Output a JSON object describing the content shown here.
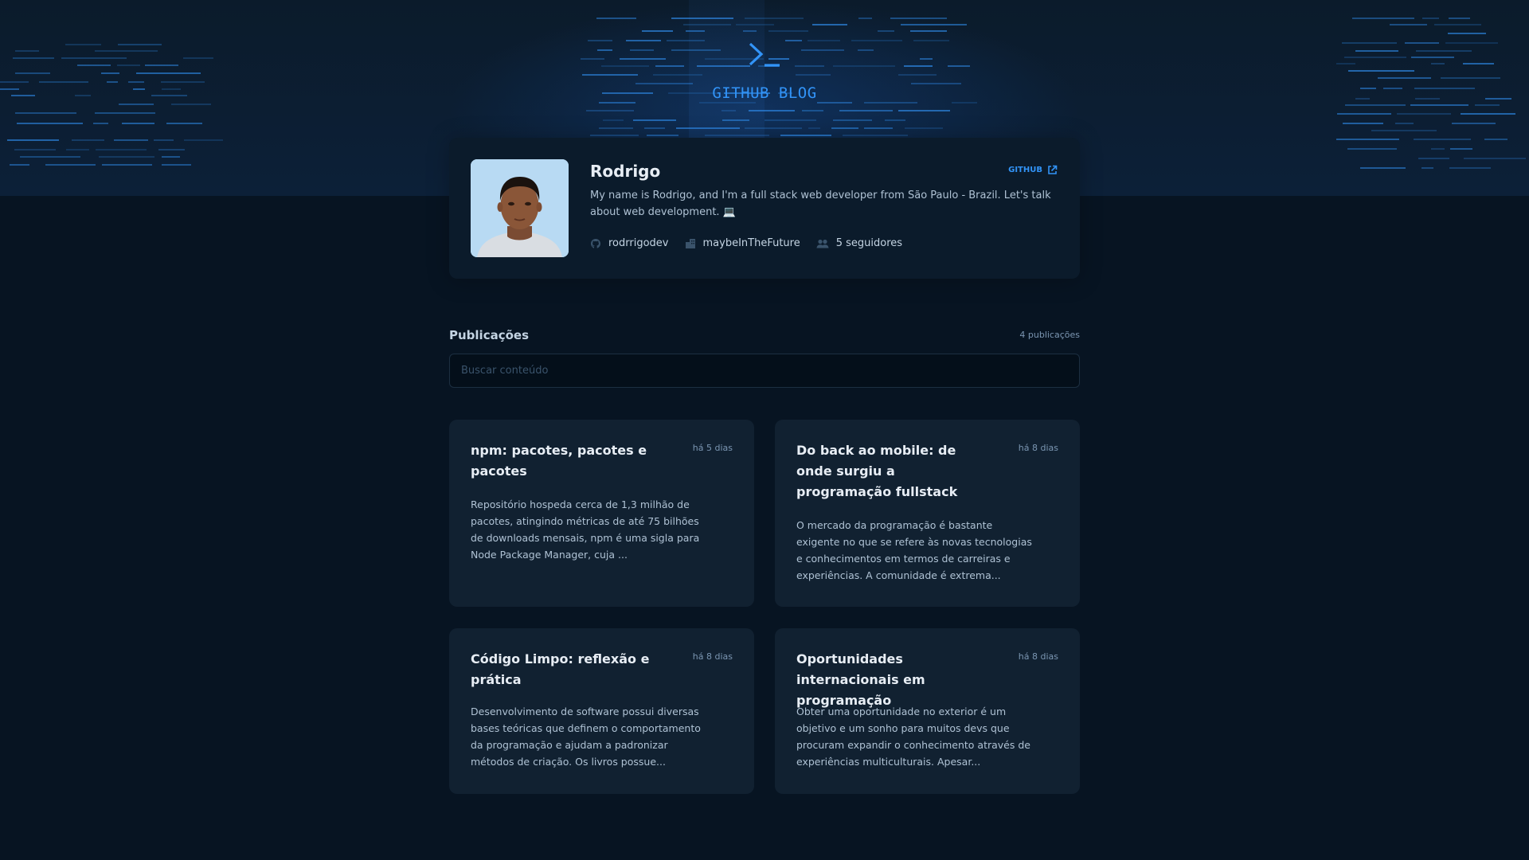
{
  "app": {
    "brand": "GITHUB BLOG",
    "logo_icon": "terminal-prompt-icon",
    "accent_color": "#3294F8"
  },
  "profile": {
    "name": "Rodrigo",
    "github_label": "GITHUB",
    "bio": "My name is Rodrigo, and I'm a full stack web developer from São Paulo - Brazil. Let's talk about web development. 💻",
    "username": "rodrrigodev",
    "company": "maybeInTheFuture",
    "followers": "5 seguidores"
  },
  "publications": {
    "title": "Publicações",
    "count": "4 publicações",
    "search_placeholder": "Buscar conteúdo",
    "posts": [
      {
        "title": "npm: pacotes, pacotes e pacotes",
        "date": "há 5 dias",
        "excerpt": "Repositório hospeda cerca de 1,3 milhão de pacotes, atingindo métricas de até 75 bilhões de downloads mensais, npm é uma sigla para Node Package Manager, cuja ..."
      },
      {
        "title": "Do back ao mobile: de onde surgiu a programação fullstack",
        "date": "há 8 dias",
        "excerpt": "O mercado da programação é bastante exigente no que se refere às novas tecnologias e conhecimentos em termos de carreiras e experiências. A comunidade é extrema..."
      },
      {
        "title": "Código Limpo: reflexão e prática",
        "date": "há 8 dias",
        "excerpt": "Desenvolvimento de software possui diversas bases teóricas que definem o comportamento da programação e ajudam a padronizar métodos de criação. Os livros possue..."
      },
      {
        "title": "Oportunidades internacionais em programação",
        "date": "há 8 dias",
        "excerpt": "Obter uma oportunidade no exterior é um objetivo e um sonho para muitos devs que procuram expandir o conhecimento através de experiências multiculturais. Apesar..."
      }
    ]
  }
}
